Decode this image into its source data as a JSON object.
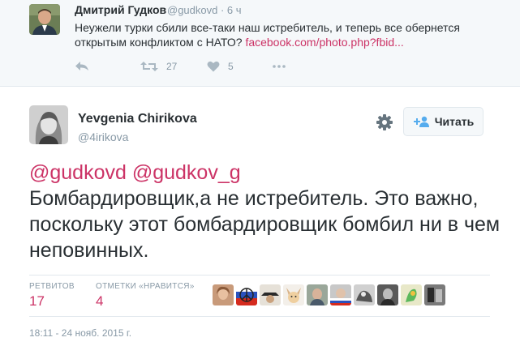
{
  "parent_tweet": {
    "author_name": "Дмитрий Гудков",
    "author_handle": "@gudkovd",
    "time_ago": "6 ч",
    "text": "Неужели турки сбили все-таки наш истребитель, и теперь все обернется открытым конфликтом с НАТО? ",
    "link": "facebook.com/photo.php?fbid...",
    "retweet_count": "27",
    "like_count": "5"
  },
  "main_tweet": {
    "author_name": "Yevgenia Chirikova",
    "author_handle": "@4irikova",
    "follow_label": "Читать",
    "mentions": "@gudkovd @gudkov_g",
    "text": "Бомбардировщик,а не истребитель. Это важно, поскольку этот бомбардировщик бомбил ни в чем неповинных.",
    "retweets_label": "РЕТВИТОВ",
    "retweets_count": "17",
    "likes_label": "ОТМЕТКИ «НРАВИТСЯ»",
    "likes_count": "4",
    "timestamp": "18:11 - 24 нояб. 2015 г."
  },
  "colors": {
    "accent": "#cc3366",
    "muted": "#8899a6",
    "text": "#292f33",
    "border": "#e1e8ed"
  },
  "icons": [
    "reply-icon",
    "retweet-icon",
    "like-icon",
    "more-icon",
    "gear-icon",
    "follow-person-icon"
  ]
}
